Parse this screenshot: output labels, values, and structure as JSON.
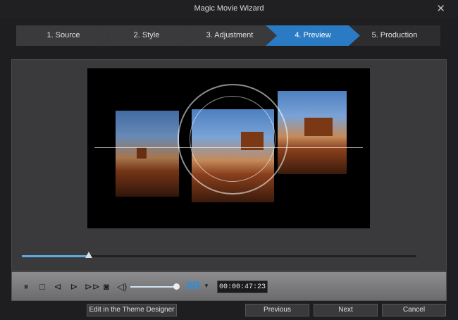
{
  "window": {
    "title": "Magic Movie Wizard",
    "close_glyph": "✕"
  },
  "steps": [
    {
      "label": "1. Source"
    },
    {
      "label": "2. Style"
    },
    {
      "label": "3. Adjustment"
    },
    {
      "label": "4. Preview"
    },
    {
      "label": "5. Production"
    }
  ],
  "player": {
    "progress_fraction": 0.17,
    "volume_fraction": 1.0,
    "btn_3d_label": "3D",
    "dropdown_glyph": "▼",
    "timecode": "00:00:47:23",
    "icons": [
      "pause-icon",
      "stop-icon",
      "previous-frame-icon",
      "next-frame-icon",
      "fast-forward-icon",
      "snapshot-icon",
      "volume-icon"
    ]
  },
  "buttons": {
    "theme_designer": "Edit in the Theme Designer",
    "previous": "Previous",
    "next": "Next",
    "cancel": "Cancel"
  },
  "colors": {
    "accent": "#2a7bc4",
    "progress": "#5aa8e0",
    "three_d": "#2a8fe0"
  }
}
